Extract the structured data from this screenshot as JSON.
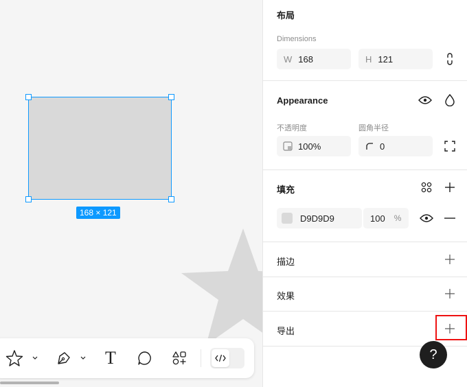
{
  "canvas": {
    "size_badge": "168 × 121"
  },
  "toolbar": {
    "tools": [
      "star-icon",
      "pen-icon",
      "text-icon",
      "comment-icon",
      "actions-icon"
    ],
    "text_tool_glyph": "T",
    "code_toggle_icon": "code-icon"
  },
  "panel": {
    "layout": {
      "title": "布局",
      "dimensions_label": "Dimensions",
      "w_prefix": "W",
      "w_value": "168",
      "h_prefix": "H",
      "h_value": "121"
    },
    "appearance": {
      "title": "Appearance",
      "opacity_label": "不透明度",
      "opacity_value": "100%",
      "radius_label": "圆角半径",
      "radius_value": "0"
    },
    "fill": {
      "title": "填充",
      "color_hex": "D9D9D9",
      "swatch_color": "#d9d9d9",
      "opacity": "100",
      "percent": "%"
    },
    "stroke": {
      "title": "描边"
    },
    "effects": {
      "title": "效果"
    },
    "export": {
      "title": "导出"
    },
    "help_label": "?"
  },
  "colors": {
    "accent": "#0d99ff",
    "highlight": "#ee1111"
  }
}
